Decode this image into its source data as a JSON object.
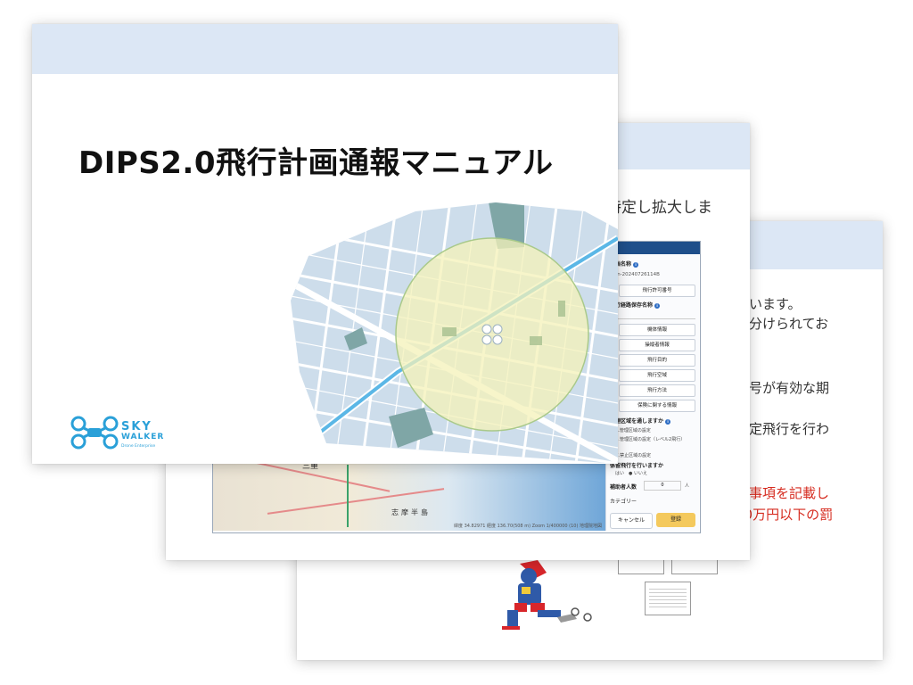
{
  "slide3": {
    "lines": [
      {
        "text": "ています。",
        "red": false
      },
      {
        "text": "に分けられてお",
        "red": false
      },
      {
        "text": "記号が有効な期",
        "red": false
      },
      {
        "text": "特定飛行を行わ",
        "red": false
      },
      {
        "text": "き事項を記載し",
        "red": true
      },
      {
        "text": "10万円以下の罰",
        "red": true
      }
    ]
  },
  "slide2": {
    "heading": "特定し拡大しま",
    "panel": {
      "project_label": "計画名称",
      "project_value": "Plan-20240726114B",
      "permit_button": "飛行許可番号",
      "insurance_label": "飛行経路保存名称",
      "buttons": [
        "機体情報",
        "操縦者情報",
        "飛行目的",
        "飛行空域",
        "飛行方法",
        "保険に関する情報"
      ],
      "question1": "管理区域を通しますか",
      "options": [
        "A.管理区域の設定",
        "B.管理区域の設定（レベル2飛行）",
        "C.禁止区域の設定"
      ],
      "question2": "係留飛行を行いますか",
      "yesno": "はい　● いいえ",
      "assistants_label": "補助者人数",
      "assistants_value": "0",
      "assistants_unit": "人",
      "category_label": "カテゴリー",
      "cancel": "キャンセル",
      "register": "登録"
    },
    "map_labels": {
      "region": "三重",
      "peninsula": "志摩半島"
    },
    "map_footer": "緯度 34.82971  経度 136.70(508 m) Zoom 1/400000 (10)  地理院地図"
  },
  "slide1": {
    "title": "DIPS2.0飛行計画通報マニュアル",
    "logo": {
      "line1": "SKY",
      "line2": "WALKER",
      "line3": "Drone Enterprise"
    }
  }
}
